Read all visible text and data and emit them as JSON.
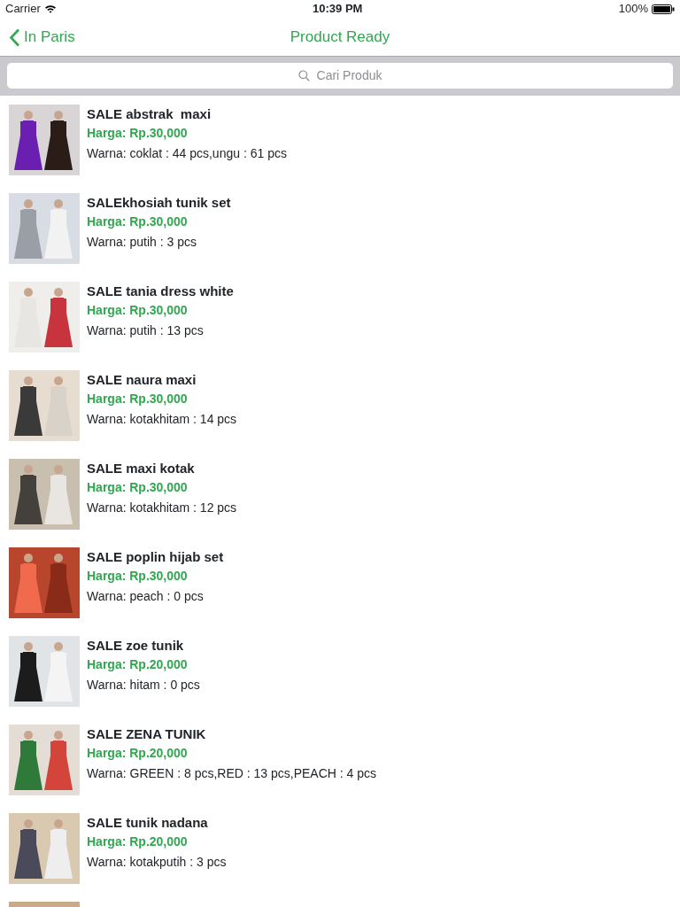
{
  "status_bar": {
    "carrier": "Carrier",
    "time": "10:39 PM",
    "battery": "100%"
  },
  "nav": {
    "back": "In Paris",
    "title": "Product Ready"
  },
  "search": {
    "placeholder": "Cari Produk"
  },
  "products": [
    {
      "kind": "full",
      "title": "SALE abstrak  maxi",
      "price": "Harga: Rp.30,000",
      "colors": "Warna: coklat : 44 pcs,ungu : 61 pcs"
    },
    {
      "kind": "full",
      "title": "SALEkhosiah tunik set",
      "price": "Harga: Rp.30,000",
      "colors": "Warna: putih : 3 pcs"
    },
    {
      "kind": "full",
      "title": "SALE tania dress white",
      "price": "Harga: Rp.30,000",
      "colors": "Warna: putih : 13 pcs"
    },
    {
      "kind": "full",
      "title": "SALE naura maxi",
      "price": "Harga: Rp.30,000",
      "colors": "Warna: kotakhitam : 14 pcs"
    },
    {
      "kind": "full",
      "title": "SALE maxi kotak",
      "price": "Harga: Rp.30,000",
      "colors": "Warna: kotakhitam : 12 pcs"
    },
    {
      "kind": "full",
      "title": "SALE poplin hijab set",
      "price": "Harga: Rp.30,000",
      "colors": "Warna: peach : 0 pcs"
    },
    {
      "kind": "full",
      "title": "SALE zoe tunik",
      "price": "Harga: Rp.20,000",
      "colors": "Warna: hitam : 0 pcs"
    },
    {
      "kind": "full",
      "title": "SALE ZENA TUNIK",
      "price": "Harga: Rp.20,000",
      "colors": "Warna: GREEN : 8 pcs,RED : 13 pcs,PEACH : 4 pcs"
    },
    {
      "kind": "full",
      "title": "SALE tunik nadana",
      "price": "Harga: Rp.20,000",
      "colors": "Warna: kotakputih : 3 pcs"
    },
    {
      "kind": "cut"
    }
  ]
}
